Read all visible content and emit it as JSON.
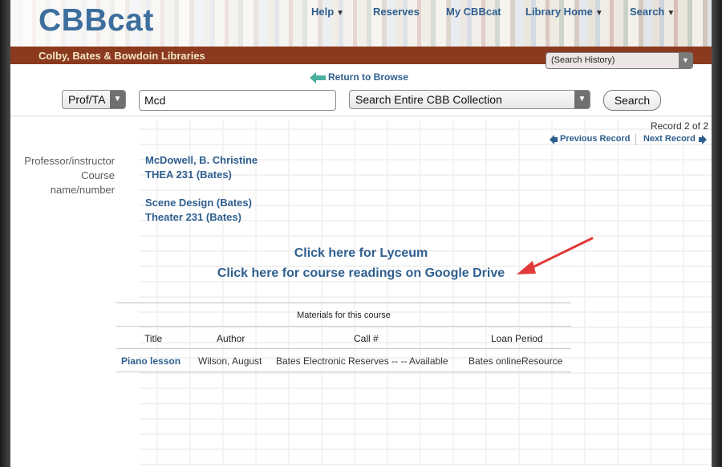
{
  "header": {
    "logo": "CBBcat",
    "nav": [
      {
        "label": "Help",
        "caret": "▼"
      },
      {
        "label": "Reserves"
      },
      {
        "label": "My CBBcat"
      },
      {
        "label": "Library Home",
        "caret": "▼"
      },
      {
        "label": "Search",
        "caret": "▼"
      }
    ],
    "library_name": "Colby, Bates & Bowdoin Libraries",
    "search_history": "(Search History)"
  },
  "return_link": "Return to Browse",
  "search": {
    "type": "Prof/TA",
    "query": "Mcd",
    "scope": "Search Entire CBB Collection",
    "button": "Search"
  },
  "record": {
    "count": "Record 2 of 2",
    "previous": "Previous Record",
    "next": "Next Record",
    "labels": {
      "professor": "Professor/instructor",
      "course_1": "Course",
      "course_2": "name/number"
    },
    "professor": "McDowell, B. Christine",
    "course_numbers": [
      "THEA 231 (Bates)",
      "Scene Design (Bates)",
      "Theater 231 (Bates)"
    ]
  },
  "links": {
    "lyceum": "Click here for Lyceum",
    "drive": "Click here for course readings on Google Drive"
  },
  "materials": {
    "caption": "Materials for this course",
    "headers": [
      "Title",
      "Author",
      "Call #",
      "Loan Period"
    ],
    "rows": [
      {
        "title": "Piano lesson",
        "author": "Wilson, August",
        "call": "Bates Electronic Reserves -- -- Available",
        "loan": "Bates onlineResource"
      }
    ]
  },
  "colors": {
    "link_blue": "#2f5f8f",
    "banner_red": "#8b3a1f",
    "annotation_arrow": "#e23b3b"
  }
}
